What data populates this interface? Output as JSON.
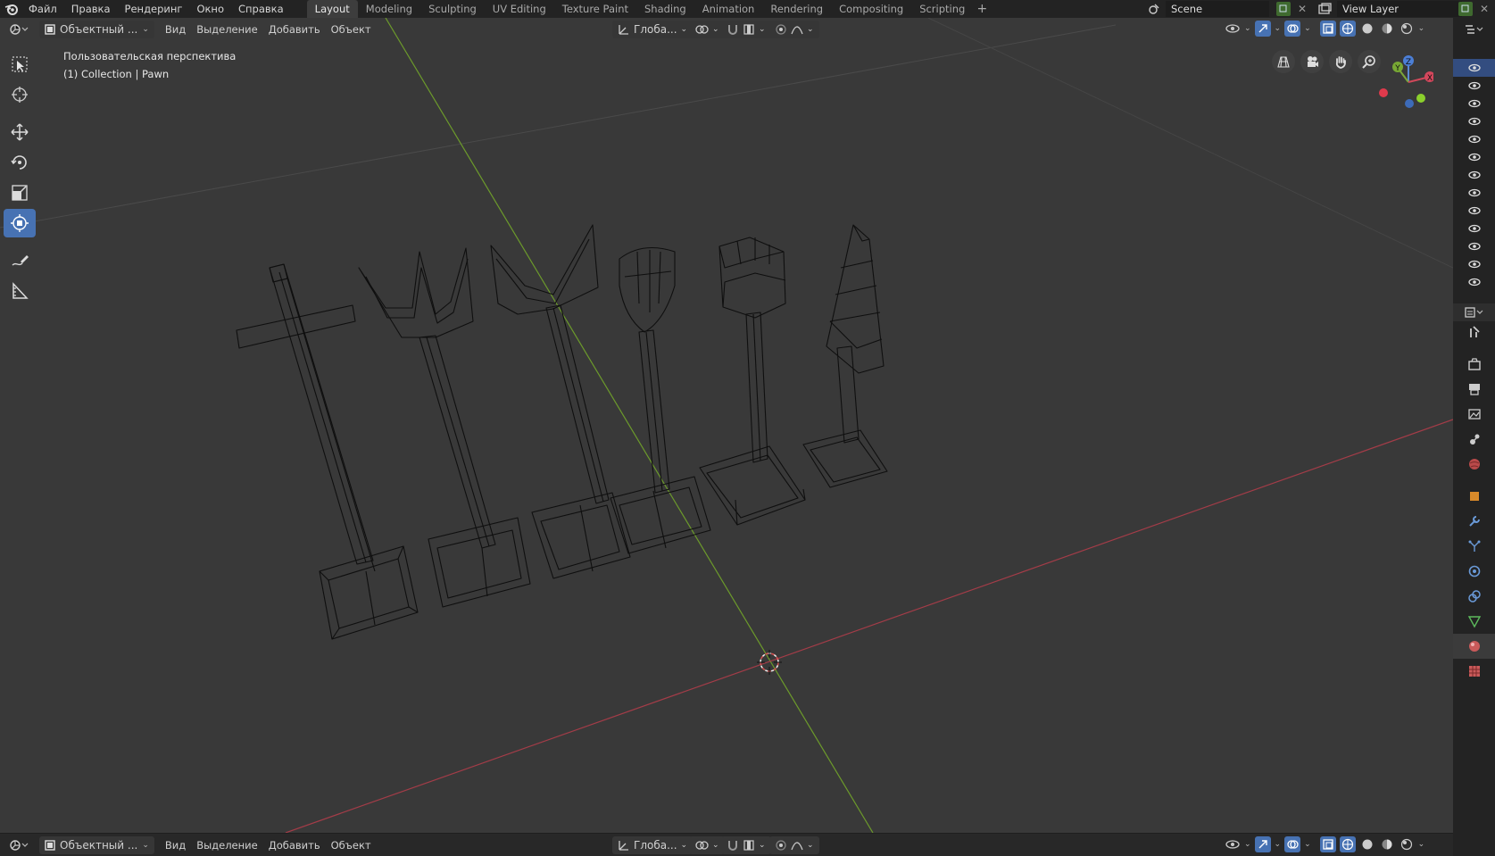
{
  "app": {
    "menus": [
      "Файл",
      "Правка",
      "Рендеринг",
      "Окно",
      "Справка"
    ],
    "workspaces": [
      "Layout",
      "Modeling",
      "Sculpting",
      "UV Editing",
      "Texture Paint",
      "Shading",
      "Animation",
      "Rendering",
      "Compositing",
      "Scripting"
    ],
    "active_workspace": "Layout",
    "add_workspace": "+",
    "scene_name": "Scene",
    "view_layer_name": "View Layer"
  },
  "header": {
    "mode": "Объектный ...",
    "menu_view": "Вид",
    "menu_select": "Выделение",
    "menu_add": "Добавить",
    "menu_object": "Объект",
    "orientation": "Глоба..."
  },
  "viewport": {
    "perspective_label": "Пользовательская перспектива",
    "collection_label": "(1) Collection | Pawn",
    "gizmo_axes": {
      "x": "X",
      "y": "Y",
      "z": "Z"
    },
    "shading": "wireframe"
  },
  "outliner": {
    "visible_rows": 13,
    "selected_row": 0
  },
  "properties_tabs": [
    "tool",
    "render",
    "output",
    "view-layer",
    "scene",
    "world",
    "object",
    "modifiers",
    "particles",
    "physics",
    "constraints",
    "data",
    "material",
    "texture"
  ],
  "colors": {
    "x_axis": "#a33c48",
    "y_axis": "#6c9a2b",
    "accent": "#4772b3",
    "wire": "#0b0b0b"
  }
}
